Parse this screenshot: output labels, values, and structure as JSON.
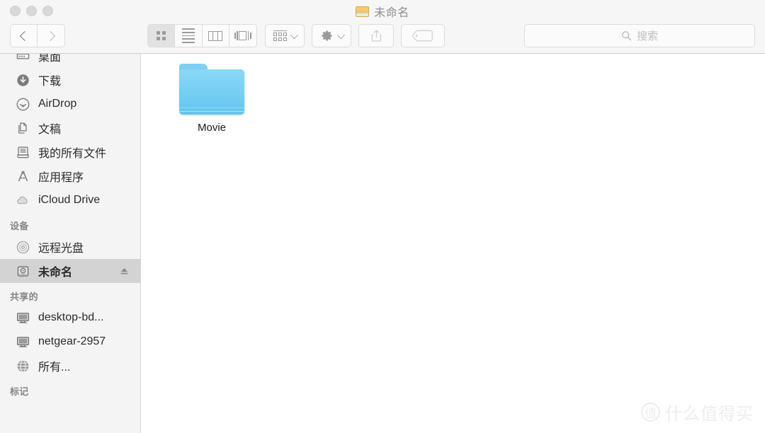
{
  "window": {
    "title": "未命名",
    "title_icon": "hard-drive-icon",
    "traffic_lights": [
      "close-button",
      "minimize-button",
      "zoom-button"
    ]
  },
  "toolbar": {
    "nav": {
      "back_label": "chevron-left-icon",
      "forward_label": "chevron-right-icon"
    },
    "view_modes": [
      {
        "name": "icon-view",
        "active": true
      },
      {
        "name": "list-view",
        "active": false
      },
      {
        "name": "column-view",
        "active": false
      },
      {
        "name": "coverflow-view",
        "active": false
      }
    ],
    "arrange": {
      "icon": "arrange-icon"
    },
    "action": {
      "icon": "gear-icon"
    },
    "share": {
      "icon": "share-icon"
    },
    "tag": {
      "icon": "tag-icon"
    }
  },
  "search": {
    "placeholder": "搜索",
    "value": "",
    "icon": "search-icon"
  },
  "sidebar": {
    "favorites": [
      {
        "label": "桌面",
        "icon": "desktop-icon",
        "selected": false
      },
      {
        "label": "下载",
        "icon": "downloads-icon",
        "selected": false
      },
      {
        "label": "AirDrop",
        "icon": "airdrop-icon",
        "selected": false
      },
      {
        "label": "文稿",
        "icon": "documents-icon",
        "selected": false
      },
      {
        "label": "我的所有文件",
        "icon": "all-my-files-icon",
        "selected": false
      },
      {
        "label": "应用程序",
        "icon": "applications-icon",
        "selected": false
      },
      {
        "label": "iCloud Drive",
        "icon": "icloud-icon",
        "selected": false
      }
    ],
    "devices_header": "设备",
    "devices": [
      {
        "label": "远程光盘",
        "icon": "remote-disc-icon",
        "selected": false,
        "eject": false
      },
      {
        "label": "未命名",
        "icon": "hard-drive-icon",
        "selected": true,
        "eject": true
      }
    ],
    "shared_header": "共享的",
    "shared": [
      {
        "label": "desktop-bd...",
        "icon": "computer-icon"
      },
      {
        "label": "netgear-2957",
        "icon": "computer-icon"
      },
      {
        "label": "所有...",
        "icon": "network-globe-icon"
      }
    ],
    "tags_header": "标记"
  },
  "content": {
    "items": [
      {
        "label": "Movie",
        "type": "folder",
        "icon": "folder-icon"
      }
    ]
  },
  "watermark": {
    "logo_char": "值",
    "text": "什么值得买"
  },
  "colors": {
    "titlebar": "#f6f6f6",
    "sidebar": "#f4f4f5",
    "content": "#ffffff",
    "selection": "#d3d3d3",
    "folder": "#60c6ef",
    "title_drive": "#f0bd50"
  }
}
